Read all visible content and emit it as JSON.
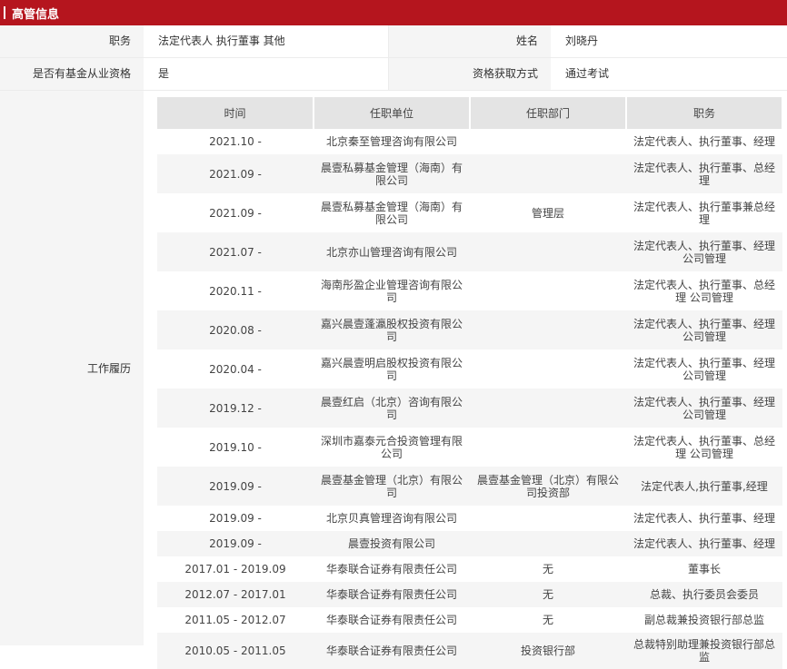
{
  "section_title": "高管信息",
  "info": {
    "row1": {
      "label1": "职务",
      "value1": "法定代表人 执行董事 其他",
      "label2": "姓名",
      "value2": "刘晓丹"
    },
    "row2": {
      "label1": "是否有基金从业资格",
      "value1": "是",
      "label2": "资格获取方式",
      "value2": "通过考试"
    }
  },
  "history": {
    "label": "工作履历",
    "headers": [
      "时间",
      "任职单位",
      "任职部门",
      "职务"
    ],
    "rows": [
      {
        "time": "2021.10 -",
        "org": "北京秦至管理咨询有限公司",
        "dept": "",
        "title": "法定代表人、执行董事、经理"
      },
      {
        "time": "2021.09 -",
        "org": "晨壹私募基金管理（海南）有限公司",
        "dept": "",
        "title": "法定代表人、执行董事、总经理"
      },
      {
        "time": "2021.09 -",
        "org": "晨壹私募基金管理（海南）有限公司",
        "dept": "管理层",
        "title": "法定代表人、执行董事兼总经理"
      },
      {
        "time": "2021.07 -",
        "org": "北京亦山管理咨询有限公司",
        "dept": "",
        "title": "法定代表人、执行董事、经理公司管理"
      },
      {
        "time": "2020.11 -",
        "org": "海南彤盈企业管理咨询有限公司",
        "dept": "",
        "title": "法定代表人、执行董事、总经理 公司管理"
      },
      {
        "time": "2020.08 -",
        "org": "嘉兴晨壹蓬瀛股权投资有限公司",
        "dept": "",
        "title": "法定代表人、执行董事、经理公司管理"
      },
      {
        "time": "2020.04 -",
        "org": "嘉兴晨壹明启股权投资有限公司",
        "dept": "",
        "title": "法定代表人、执行董事、经理公司管理"
      },
      {
        "time": "2019.12 -",
        "org": "晨壹红启（北京）咨询有限公司",
        "dept": "",
        "title": "法定代表人、执行董事、经理公司管理"
      },
      {
        "time": "2019.10 -",
        "org": "深圳市嘉泰元合投资管理有限公司",
        "dept": "",
        "title": "法定代表人、执行董事、总经理 公司管理"
      },
      {
        "time": "2019.09 -",
        "org": "晨壹基金管理（北京）有限公司",
        "dept": "晨壹基金管理（北京）有限公司投资部",
        "title": "法定代表人,执行董事,经理"
      },
      {
        "time": "2019.09 -",
        "org": "北京贝真管理咨询有限公司",
        "dept": "",
        "title": "法定代表人、执行董事、经理"
      },
      {
        "time": "2019.09 -",
        "org": "晨壹投资有限公司",
        "dept": "",
        "title": "法定代表人、执行董事、经理"
      },
      {
        "time": "2017.01 - 2019.09",
        "org": "华泰联合证券有限责任公司",
        "dept": "无",
        "title": "董事长"
      },
      {
        "time": "2012.07 - 2017.01",
        "org": "华泰联合证券有限责任公司",
        "dept": "无",
        "title": "总裁、执行委员会委员"
      },
      {
        "time": "2011.05 - 2012.07",
        "org": "华泰联合证券有限责任公司",
        "dept": "无",
        "title": "副总裁兼投资银行部总监"
      },
      {
        "time": "2010.05 - 2011.05",
        "org": "华泰联合证券有限责任公司",
        "dept": "投资银行部",
        "title": "总裁特别助理兼投资银行部总监"
      }
    ]
  }
}
